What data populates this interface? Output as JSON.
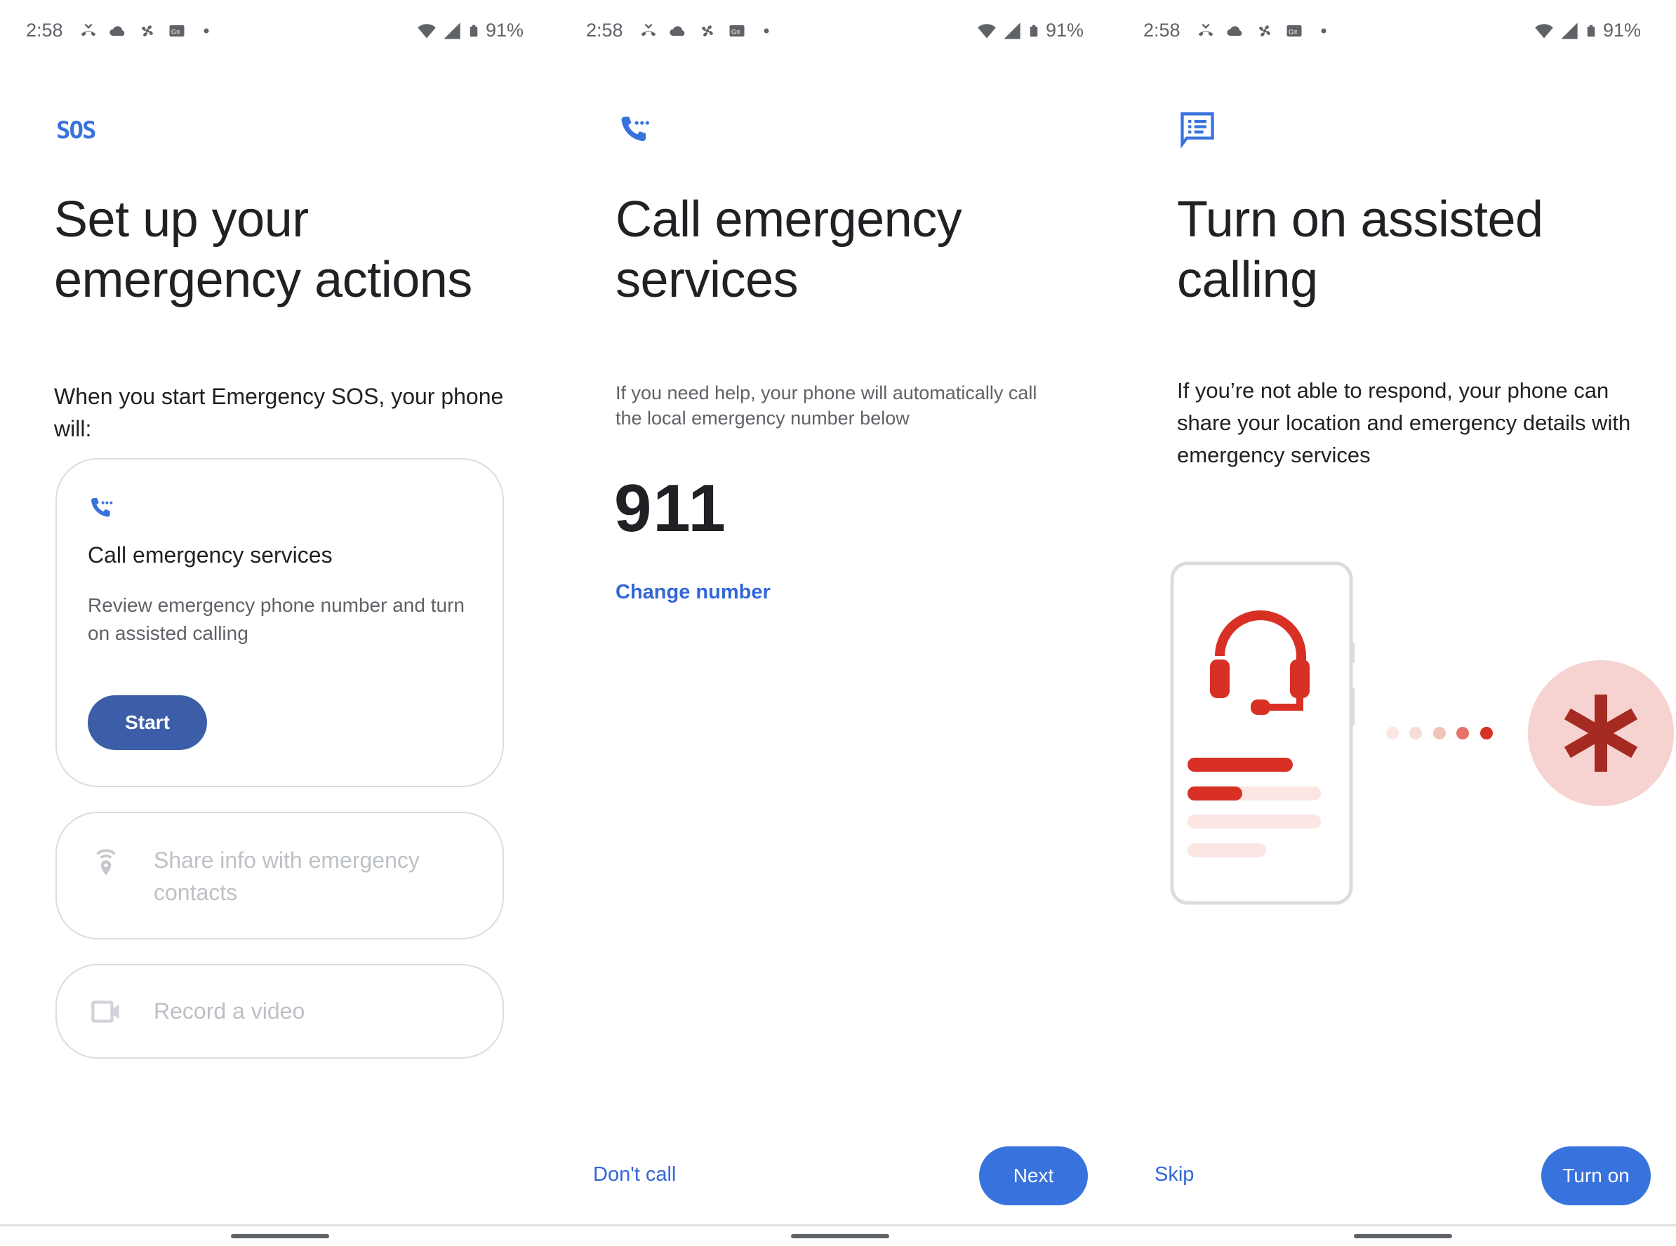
{
  "status_bar": {
    "time": "2:58",
    "battery": "91%",
    "left_icons": [
      "missed-call-icon",
      "cloud-icon",
      "fan-icon",
      "news-icon",
      "dot-icon"
    ],
    "right_icons": [
      "wifi-icon",
      "signal-icon",
      "battery-icon"
    ]
  },
  "screens": [
    {
      "icon": "sos-icon",
      "icon_text": "SOS",
      "title_line1": "Set up your",
      "title_line2": "emergency actions",
      "intro": "When you start Emergency SOS, your phone will:",
      "cards": [
        {
          "icon": "phone-dots-icon",
          "title": "Call emergency services",
          "description": "Review emergency phone number and turn on assisted calling",
          "button": "Start",
          "enabled": true
        },
        {
          "icon": "location-share-icon",
          "title": "Share info with emergency contacts",
          "enabled": false
        },
        {
          "icon": "video-camera-icon",
          "title": "Record a video",
          "enabled": false
        }
      ]
    },
    {
      "icon": "phone-dots-icon",
      "title_line1": "Call emergency",
      "title_line2": "services",
      "description": "If you need help, your phone will automatically call the local emergency number below",
      "emergency_number": "911",
      "change_link": "Change number",
      "secondary_button": "Don't call",
      "primary_button": "Next"
    },
    {
      "icon": "message-list-icon",
      "title_line1": "Turn on assisted",
      "title_line2": "calling",
      "description": "If you’re not able to respond, your phone can share your location and emergency details with emergency services",
      "illustration": "phone-headset-to-emergency-illustration",
      "secondary_button": "Skip",
      "primary_button": "Turn on"
    }
  ],
  "colors": {
    "accent_blue": "#3872dd",
    "start_button": "#3c5ea8",
    "illustration_red": "#d93025",
    "illustration_pink": "#f6d3d1"
  }
}
